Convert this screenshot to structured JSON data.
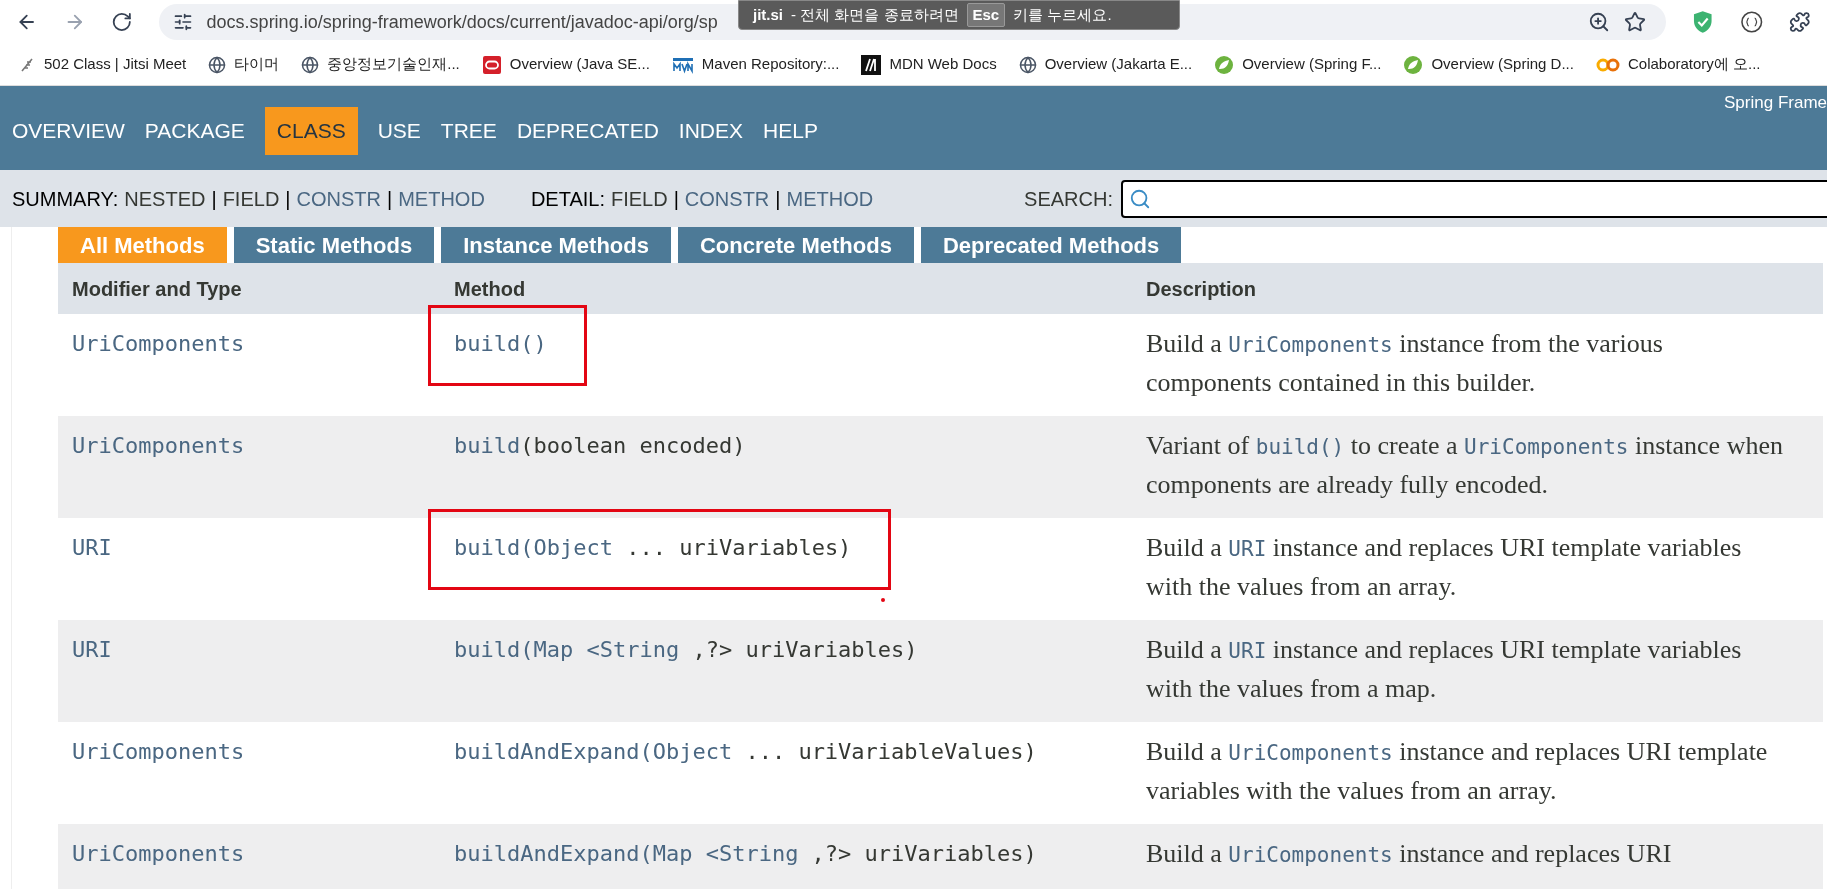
{
  "browser": {
    "nav": [
      {
        "kind": "back",
        "disabled": false
      },
      {
        "kind": "forward",
        "disabled": true
      },
      {
        "kind": "reload",
        "disabled": false
      }
    ],
    "url": "docs.spring.io/spring-framework/docs/current/javadoc-api/org/sp",
    "notice": {
      "brand": "jit.si",
      "text": "- 전체 화면을 종료하려면",
      "key": "Esc",
      "after": "키를 누르세요."
    },
    "bookmarks": [
      {
        "kind": "jitsi",
        "label": "502 Class | Jitsi Meet"
      },
      {
        "kind": "globe",
        "label": "타이머"
      },
      {
        "kind": "globe",
        "label": "중앙정보기술인재..."
      },
      {
        "kind": "oracle",
        "label": "Overview (Java SE..."
      },
      {
        "kind": "maven",
        "label": "Maven Repository:..."
      },
      {
        "kind": "mdn",
        "label": "MDN Web Docs"
      },
      {
        "kind": "globe",
        "label": "Overview (Jakarta E..."
      },
      {
        "kind": "spring",
        "label": "Overview (Spring F..."
      },
      {
        "kind": "spring",
        "label": "Overview (Spring D..."
      },
      {
        "kind": "colab",
        "label": "Colaboratory에 오..."
      }
    ]
  },
  "javadoc": {
    "nav_items": [
      {
        "label": "OVERVIEW",
        "selected": false
      },
      {
        "label": "PACKAGE",
        "selected": false
      },
      {
        "label": "CLASS",
        "selected": true
      },
      {
        "label": "USE",
        "selected": false
      },
      {
        "label": "TREE",
        "selected": false
      },
      {
        "label": "DEPRECATED",
        "selected": false
      },
      {
        "label": "INDEX",
        "selected": false
      },
      {
        "label": "HELP",
        "selected": false
      }
    ],
    "brand": "Spring Frame",
    "separator": "|",
    "summary": {
      "label": "SUMMARY:",
      "items": [
        {
          "label": "NESTED",
          "link": false
        },
        {
          "label": "FIELD",
          "link": false
        },
        {
          "label": "CONSTR",
          "link": true
        },
        {
          "label": "METHOD",
          "link": true
        }
      ]
    },
    "detail": {
      "label": "DETAIL:",
      "items": [
        {
          "label": "FIELD",
          "link": false
        },
        {
          "label": "CONSTR",
          "link": true
        },
        {
          "label": "METHOD",
          "link": true
        }
      ]
    },
    "search": {
      "label": "SEARCH:"
    },
    "tabs": [
      {
        "label": "All Methods",
        "selected": true
      },
      {
        "label": "Static Methods",
        "selected": false
      },
      {
        "label": "Instance Methods",
        "selected": false
      },
      {
        "label": "Concrete Methods",
        "selected": false
      },
      {
        "label": "Deprecated Methods",
        "selected": false
      }
    ],
    "table": {
      "columns": [
        "Modifier and Type",
        "Method",
        "Description"
      ],
      "rows": [
        {
          "type": "UriComponents",
          "highlighted": true,
          "annotation_dot": false,
          "method": [
            {
              "kind": "link",
              "text": "build()"
            }
          ],
          "description": [
            {
              "kind": "text",
              "text": "Build a "
            },
            {
              "kind": "code",
              "text": "UriComponents"
            },
            {
              "kind": "text",
              "text": " instance from the various components contained in this builder."
            }
          ]
        },
        {
          "type": "UriComponents",
          "highlighted": false,
          "annotation_dot": false,
          "method": [
            {
              "kind": "link",
              "text": "build"
            },
            {
              "kind": "text",
              "text": "(boolean encoded)"
            }
          ],
          "description": [
            {
              "kind": "text",
              "text": "Variant of "
            },
            {
              "kind": "code",
              "text": "build()"
            },
            {
              "kind": "text",
              "text": " to create a "
            },
            {
              "kind": "code",
              "text": "UriComponents"
            },
            {
              "kind": "text",
              "text": " instance when components are already fully encoded."
            }
          ]
        },
        {
          "type": "URI",
          "highlighted": true,
          "annotation_dot": true,
          "method": [
            {
              "kind": "link",
              "text": "build(Object"
            },
            {
              "kind": "text",
              "text": " ... uriVariables)"
            }
          ],
          "description": [
            {
              "kind": "text",
              "text": "Build a "
            },
            {
              "kind": "code",
              "text": "URI"
            },
            {
              "kind": "text",
              "text": "  instance and replaces URI template variables with the values from an array."
            }
          ]
        },
        {
          "type": "URI",
          "highlighted": false,
          "annotation_dot": false,
          "method": [
            {
              "kind": "link",
              "text": "build(Map <String"
            },
            {
              "kind": "text",
              "text": " ,?> uriVariables)"
            }
          ],
          "description": [
            {
              "kind": "text",
              "text": "Build a "
            },
            {
              "kind": "code",
              "text": "URI"
            },
            {
              "kind": "text",
              "text": "  instance and replaces URI template variables with the values from a map."
            }
          ]
        },
        {
          "type": "UriComponents",
          "highlighted": false,
          "annotation_dot": false,
          "method": [
            {
              "kind": "link",
              "text": "buildAndExpand(Object"
            },
            {
              "kind": "text",
              "text": " ... uriVariableValues)"
            }
          ],
          "description": [
            {
              "kind": "text",
              "text": "Build a "
            },
            {
              "kind": "code",
              "text": "UriComponents"
            },
            {
              "kind": "text",
              "text": " instance and replaces URI template variables with the values from an array."
            }
          ]
        },
        {
          "type": "UriComponents",
          "highlighted": false,
          "annotation_dot": false,
          "method": [
            {
              "kind": "link",
              "text": "buildAndExpand(Map <String"
            },
            {
              "kind": "text",
              "text": " ,?> uriVariables)"
            }
          ],
          "description": [
            {
              "kind": "text",
              "text": "Build a "
            },
            {
              "kind": "code",
              "text": "UriComponents"
            },
            {
              "kind": "text",
              "text": " instance and replaces URI"
            }
          ]
        }
      ]
    }
  }
}
